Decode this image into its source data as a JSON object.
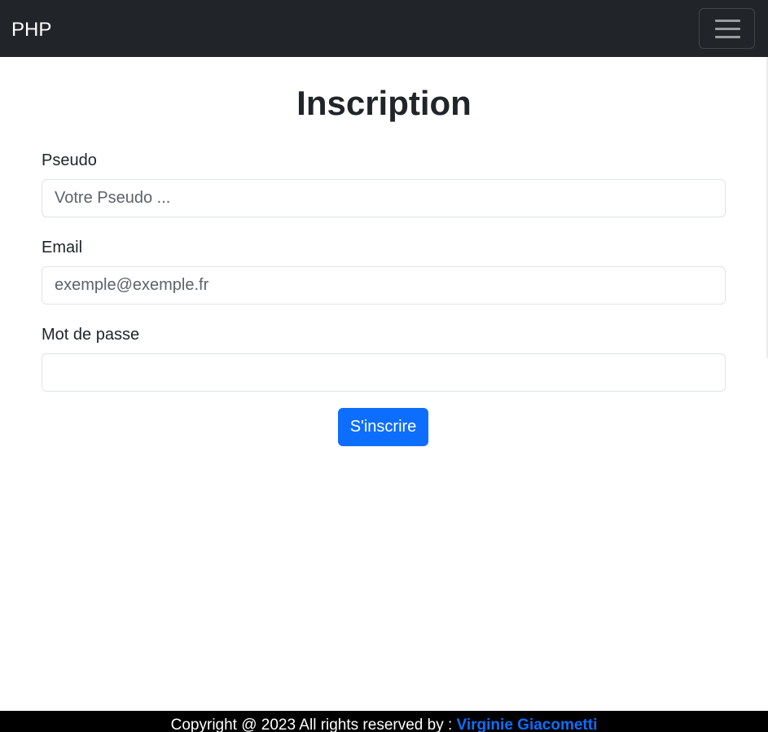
{
  "navbar": {
    "brand": "PHP",
    "toggler_icon": "hamburger-menu-icon"
  },
  "form": {
    "title": "Inscription",
    "pseudo": {
      "label": "Pseudo",
      "placeholder": "Votre Pseudo ..."
    },
    "email": {
      "label": "Email",
      "placeholder": "exemple@exemple.fr"
    },
    "password": {
      "label": "Mot de passe",
      "placeholder": ""
    },
    "submit_label": "S'inscrire"
  },
  "footer": {
    "text": "Copyright @ 2023 All rights reserved by : ",
    "author": "Virginie Giacometti"
  },
  "colors": {
    "navbar_bg": "#212529",
    "primary": "#0d6efd",
    "footer_bg": "#000000"
  }
}
